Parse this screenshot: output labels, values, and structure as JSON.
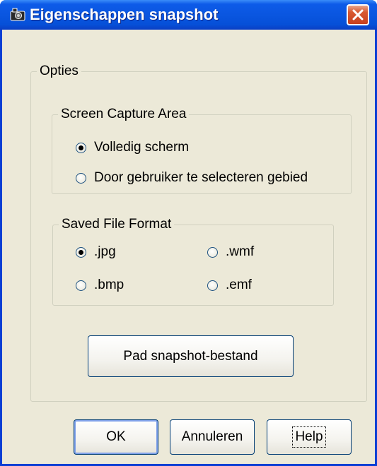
{
  "window": {
    "title": "Eigenschappen snapshot",
    "icon": "camera-icon",
    "close_icon": "close-icon"
  },
  "options_group": {
    "label": "Opties",
    "capture_area": {
      "label": "Screen Capture Area",
      "options": [
        {
          "label": "Volledig scherm",
          "checked": true
        },
        {
          "label": "Door gebruiker te selecteren gebied",
          "checked": false
        }
      ]
    },
    "file_format": {
      "label": "Saved File Format",
      "options": [
        {
          "label": ".jpg",
          "checked": true
        },
        {
          "label": ".wmf",
          "checked": false
        },
        {
          "label": ".bmp",
          "checked": false
        },
        {
          "label": ".emf",
          "checked": false
        }
      ]
    },
    "path_button": "Pad snapshot-bestand"
  },
  "buttons": {
    "ok": "OK",
    "cancel": "Annuleren",
    "help": "Help"
  },
  "colors": {
    "titlebar": "#0a56e0",
    "dialog_background": "#ece9d8",
    "close_button": "#d85a32"
  }
}
